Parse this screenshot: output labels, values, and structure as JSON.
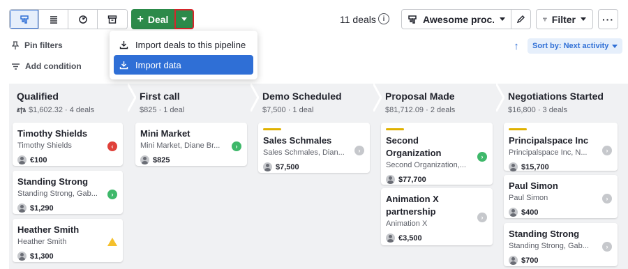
{
  "toolbar": {
    "views": [
      {
        "icon": "pipeline-view-icon",
        "active": true
      },
      {
        "icon": "list-view-icon",
        "active": false
      },
      {
        "icon": "forecast-view-icon",
        "active": false
      },
      {
        "icon": "archive-icon",
        "active": false
      }
    ],
    "deal_button_label": "Deal",
    "deal_count": "11 deals",
    "pipeline_name": "Awesome proc...",
    "filter_label": "Filter",
    "more_label": "···"
  },
  "filters": {
    "pin_filters": "Pin filters",
    "add_condition": "Add condition"
  },
  "sort": {
    "label": "Sort by: Next activity"
  },
  "dropdown": {
    "items": [
      {
        "label": "Import deals to this pipeline",
        "selected": false
      },
      {
        "label": "Import data",
        "selected": true
      }
    ]
  },
  "colors": {
    "primary_green": "#2c8a4a",
    "accent_blue": "#2f6fd6",
    "highlight_red": "#d6262b",
    "rotting_yellow": "#e0b100"
  },
  "stages": [
    {
      "name": "Qualified",
      "summary": "$1,602.32 · 4 deals",
      "has_balance_icon": true,
      "deals": [
        {
          "title": "Timothy Shields",
          "sub": "Timothy Shields",
          "value": "€100",
          "status": "red"
        },
        {
          "title": "Standing Strong",
          "sub": "Standing Strong, Gab...",
          "value": "$1,290",
          "status": "green"
        },
        {
          "title": "Heather Smith",
          "sub": "Heather Smith",
          "value": "$1,300",
          "status": "warn"
        }
      ]
    },
    {
      "name": "First call",
      "summary": "$825 · 1 deal",
      "deals": [
        {
          "title": "Mini Market",
          "sub": "Mini Market, Diane Br...",
          "value": "$825",
          "status": "green"
        }
      ]
    },
    {
      "name": "Demo Scheduled",
      "summary": "$7,500 · 1 deal",
      "deals": [
        {
          "title": "Sales Schmales",
          "sub": "Sales Schmales, Dian...",
          "value": "$7,500",
          "status": "gray",
          "rotting": true
        }
      ]
    },
    {
      "name": "Proposal Made",
      "summary": "$81,712.09 · 2 deals",
      "deals": [
        {
          "title": "Second",
          "title2": "Organization",
          "sub": "Second Organization,...",
          "value": "$77,700",
          "status": "green",
          "rotting": true
        },
        {
          "title": "Animation X",
          "title2": "partnership",
          "sub": "Animation X",
          "value": "€3,500",
          "status": "gray"
        }
      ]
    },
    {
      "name": "Negotiations Started",
      "summary": "$16,800 · 3 deals",
      "deals": [
        {
          "title": "Principalspace Inc",
          "sub": "Principalspace Inc, N...",
          "value": "$15,700",
          "status": "gray",
          "rotting": true
        },
        {
          "title": "Paul Simon",
          "sub": "Paul Simon",
          "value": "$400",
          "status": "gray"
        },
        {
          "title": "Standing Strong",
          "sub": "Standing Strong, Gab...",
          "value": "$700",
          "status": "gray"
        }
      ]
    }
  ]
}
